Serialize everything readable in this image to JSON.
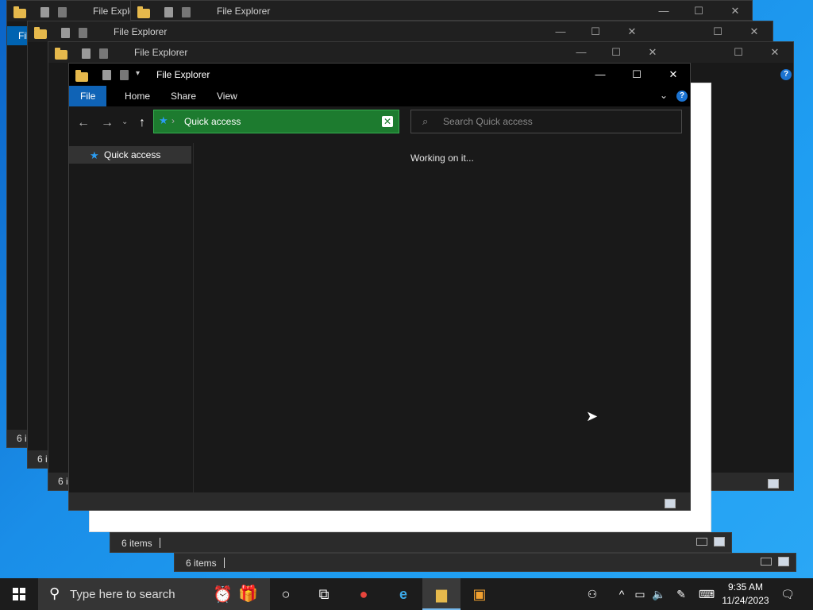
{
  "window": {
    "title": "File Explorer",
    "title_truncated": "File Explo",
    "minimize": "—",
    "maximize": "☐",
    "close": "✕"
  },
  "ribbon": {
    "tabs": [
      "File",
      "Home",
      "Share",
      "View"
    ],
    "help": "?"
  },
  "address": {
    "path": "Quick access",
    "separator": "›"
  },
  "search": {
    "placeholder": "Search Quick access"
  },
  "nav": {
    "items": [
      {
        "label": "Quick access"
      }
    ]
  },
  "content": {
    "status_text": "Working on it..."
  },
  "status_bar": {
    "item_count": "6 items",
    "item_count_truncated": "6 i"
  },
  "taskbar": {
    "search_placeholder": "Type here to search",
    "time": "9:35 AM",
    "date": "11/24/2023"
  },
  "colors": {
    "accent": "#0063b1",
    "address_bg": "#1d7b2f",
    "desktop": "#1a8ee8"
  }
}
